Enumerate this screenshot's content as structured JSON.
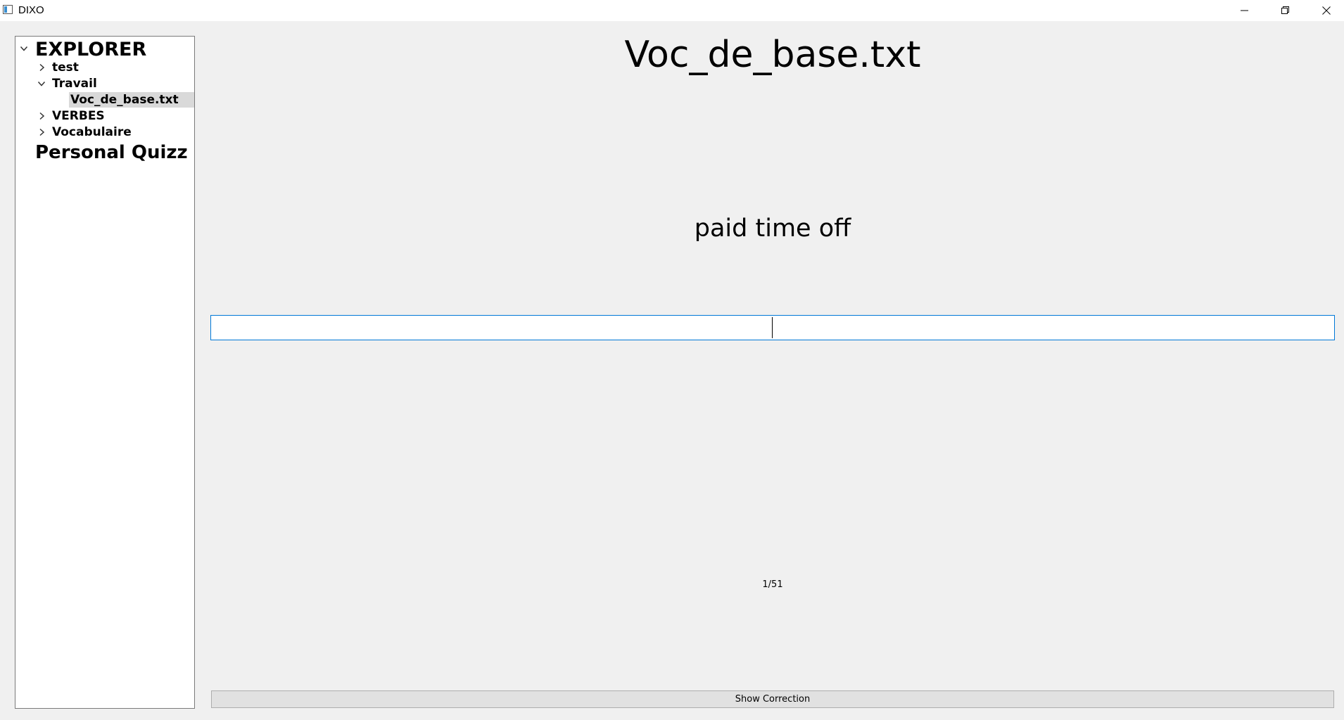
{
  "window": {
    "title": "DIXO",
    "controls": [
      "minimize-icon",
      "restore-icon",
      "close-icon"
    ]
  },
  "explorer": {
    "root_label": "EXPLORER",
    "items": [
      {
        "label": "test",
        "expanded": false,
        "icon": "chevron-right-icon"
      },
      {
        "label": "Travail",
        "expanded": true,
        "icon": "chevron-down-icon",
        "children": [
          {
            "label": "Voc_de_base.txt",
            "selected": true
          }
        ]
      },
      {
        "label": "VERBES",
        "expanded": false,
        "icon": "chevron-right-icon"
      },
      {
        "label": "Vocabulaire",
        "expanded": false,
        "icon": "chevron-right-icon"
      }
    ],
    "section_label": "Personal Quizz"
  },
  "quiz": {
    "file_title": "Voc_de_base.txt",
    "prompt": "paid time off",
    "answer_value": "",
    "progress": "1/51",
    "show_correction_label": "Show Correction"
  },
  "colors": {
    "background": "#f0f0f0",
    "input_focus_border": "#0078d7",
    "selected_item": "#d9d9d9"
  }
}
